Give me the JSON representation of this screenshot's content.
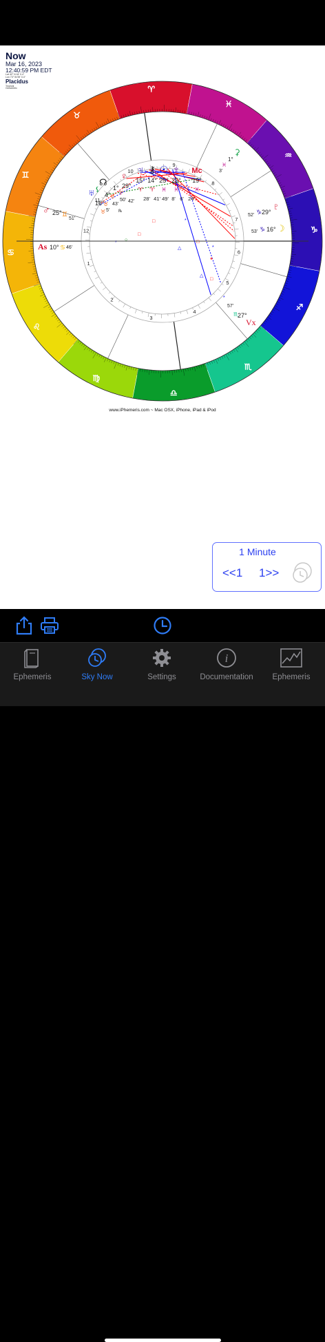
{
  "header": {
    "title": "Now",
    "date": "Mar 16, 2023",
    "time": "12:40:59 PM EDT",
    "location_line1": "Lat 40° N 44' 0.4\"",
    "location_line2": "Lon 73° W 59' 0.4\"",
    "house_system": "Placidus",
    "zodiac_line1": "Tropical",
    "zodiac_line2": "Geocentric"
  },
  "chart": {
    "footer": "www.iPhemeris.com ~ Mac OSX, iPhone, iPad & iPod",
    "house_numbers": [
      "1",
      "2",
      "3",
      "4",
      "5",
      "6",
      "7",
      "8",
      "9",
      "10",
      "11",
      "12"
    ],
    "ascendant": {
      "glyph": "As",
      "degree": "10°",
      "sign": "♋︎",
      "minutes": "46'"
    },
    "vertex": {
      "glyph": "Vx",
      "degree": "27°",
      "sign": "♏︎",
      "minutes": "57'"
    },
    "mars": {
      "glyph": "♂",
      "degree": "25°",
      "sign": "♊︎",
      "minutes": "51'"
    },
    "pluto": {
      "glyph": "♇",
      "degree": "29°",
      "sign": "♑︎",
      "minutes": "52'"
    },
    "moon": {
      "glyph": "☽",
      "degree": "16°",
      "sign": "♑︎",
      "minutes": "53'"
    },
    "eris": {
      "glyph": "⚳",
      "degree": "1°",
      "sign": "♓︎",
      "minutes": "3'"
    },
    "upper_cluster": {
      "glyphs": [
        "♃",
        "⚷",
        "☉",
        "♆",
        "Mc"
      ],
      "degrees": [
        "15°",
        "14°",
        "25°",
        "25°",
        "19°"
      ],
      "signs": [
        "♈︎",
        "♈︎",
        "♓︎",
        "♓︎",
        "♓︎"
      ],
      "minutes": [
        "28'",
        "41'",
        "49'",
        "8'",
        "6'",
        "24'"
      ]
    },
    "left_cluster": {
      "venus": {
        "glyph": "♀",
        "degree": "29°",
        "sign": "♈︎",
        "minutes": "42'"
      },
      "node": {
        "glyph": "☊",
        "degree": "1°",
        "sign": "♉︎",
        "minutes": "50'"
      },
      "uranus": {
        "glyph": "♅",
        "degree": "16°",
        "sign": "♉︎",
        "minutes": "43'"
      },
      "chiron_left": {
        "glyph": "⚸",
        "degree": "4°",
        "sign": "♉︎",
        "minutes": "5'"
      },
      "retro": "℞"
    }
  },
  "step": {
    "label": "1 Minute",
    "prev": "<<1",
    "next": "1>>"
  },
  "toolbar": {
    "share_icon": "share-icon",
    "print_icon": "printer-icon",
    "time_icon": "clock-icon"
  },
  "tabs": [
    {
      "label": "Ephemeris",
      "icon": "book-icon",
      "active": false
    },
    {
      "label": "Sky Now",
      "icon": "sky-now-icon",
      "active": true
    },
    {
      "label": "Settings",
      "icon": "gear-icon",
      "active": false
    },
    {
      "label": "Documentation",
      "icon": "info-icon",
      "active": false
    },
    {
      "label": "Ephemeris",
      "icon": "graph-icon",
      "active": false
    }
  ],
  "colors": {
    "accent": "#2f7cf6",
    "aries": "#d8102c",
    "pisces": "#c0128f",
    "aquarius": "#6a0fb0",
    "capricorn": "#2c0fb4",
    "sagittarius": "#1214d8",
    "scorpio": "#15c68e",
    "libra": "#0a9c2b",
    "virgo": "#9bd80a",
    "leo": "#eddc08",
    "cancer": "#f4b508",
    "gemini": "#f58410",
    "taurus": "#f05a0c"
  }
}
